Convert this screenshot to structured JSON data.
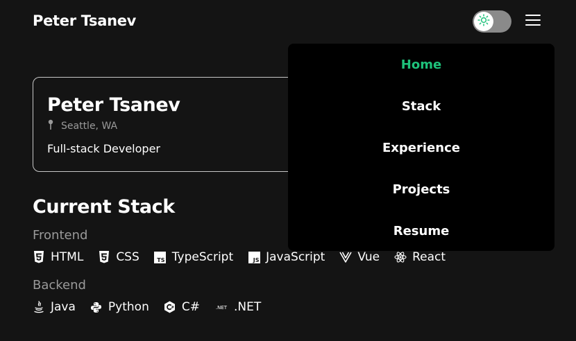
{
  "header": {
    "title": "Peter Tsanev",
    "theme_toggle_icon": "sun-icon",
    "menu_icon": "hamburger-icon"
  },
  "profile": {
    "name": "Peter Tsanev",
    "location": "Seattle, WA",
    "location_icon": "map-pin-icon",
    "role": "Full-stack Developer"
  },
  "stack": {
    "heading": "Current Stack",
    "frontend": {
      "label": "Frontend",
      "items": [
        {
          "name": "HTML",
          "icon": "html5-icon"
        },
        {
          "name": "CSS",
          "icon": "css3-icon"
        },
        {
          "name": "TypeScript",
          "icon": "typescript-icon"
        },
        {
          "name": "JavaScript",
          "icon": "javascript-icon"
        },
        {
          "name": "Vue",
          "icon": "vue-icon"
        },
        {
          "name": "React",
          "icon": "react-icon"
        }
      ]
    },
    "backend": {
      "label": "Backend",
      "items": [
        {
          "name": "Java",
          "icon": "java-icon"
        },
        {
          "name": "Python",
          "icon": "python-icon"
        },
        {
          "name": "C#",
          "icon": "csharp-icon"
        },
        {
          "name": ".NET",
          "icon": "dotnet-icon",
          "icon_text": ".NET"
        }
      ]
    }
  },
  "nav": {
    "active_color": "#1ec27b",
    "items": [
      {
        "label": "Home",
        "active": true
      },
      {
        "label": "Stack",
        "active": false
      },
      {
        "label": "Experience",
        "active": false
      },
      {
        "label": "Projects",
        "active": false
      },
      {
        "label": "Resume",
        "active": false
      }
    ]
  }
}
